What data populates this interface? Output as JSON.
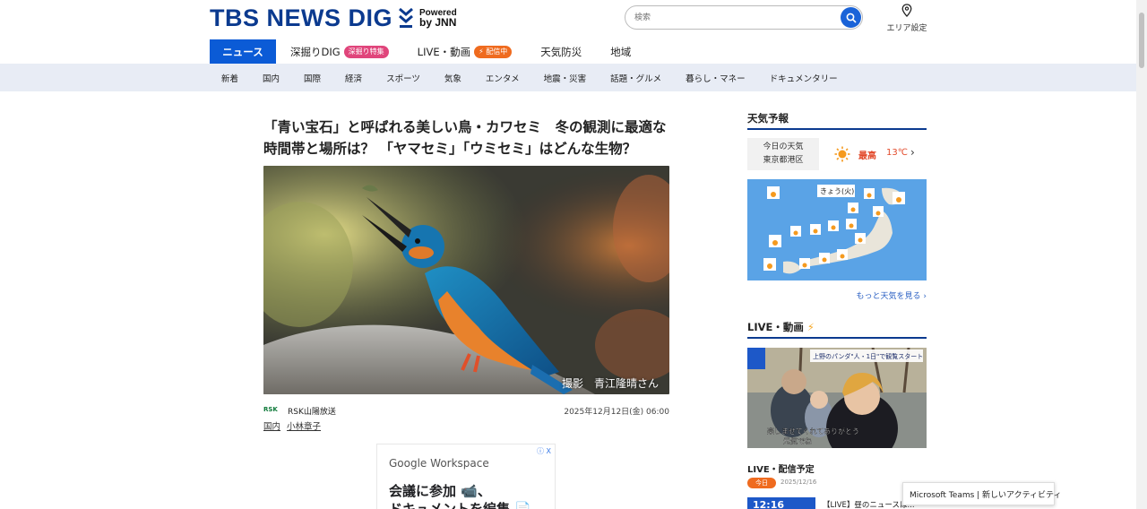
{
  "header": {
    "logo_text": "TBS NEWS DIG",
    "powered_line1": "Powered",
    "powered_line2": "by JNN",
    "search_placeholder": "検索",
    "area_label": "エリア設定"
  },
  "nav": {
    "tabs": [
      {
        "label": "ニュース",
        "active": true
      },
      {
        "label": "深掘りDIG",
        "badge": "深掘り特集"
      },
      {
        "label": "LIVE・動画",
        "badge": "⚡ 配信中"
      },
      {
        "label": "天気防災"
      },
      {
        "label": "地域"
      }
    ],
    "subnav": [
      "新着",
      "国内",
      "国際",
      "経済",
      "スポーツ",
      "気象",
      "エンタメ",
      "地震・災害",
      "話題・グルメ",
      "暮らし・マネー",
      "ドキュメンタリー"
    ]
  },
  "article": {
    "headline": "「青い宝石」と呼ばれる美しい鳥・カワセミ　冬の観測に最適な時間帯と場所は？ 「ヤマセミ」「ウミセミ」はどんな生物？",
    "photo_caption": "撮影　青江隆晴さん",
    "source_logo": "RSK",
    "source_name": "RSK山陽放送",
    "date": "2025年12月12日(金) 06:00",
    "tags": [
      "国内",
      "小林章子"
    ]
  },
  "ad": {
    "info": "ⓘ X",
    "brand_google": "Google",
    "brand_workspace": "Workspace",
    "line1": "会議に参加 📹、",
    "line2": "ドキュメントを編集 📄"
  },
  "sidebar": {
    "weather_title": "天気予報",
    "weather_loc_line1": "今日の天気",
    "weather_loc_line2": "東京都港区",
    "weather_high_label": "最高",
    "weather_temp": "13℃",
    "map_title": "きょう(火)",
    "more_weather": "もっと天気を見る ›",
    "live_title": "LIVE・動画",
    "live_overlay_top": "上野のパンダ\"人・1日\"で観覧スタート",
    "live_overlay_bottom": "楽しませてくれてありがとう\n元気でね",
    "live_sub_title": "LIVE・配信予定",
    "sched_today": "今日",
    "sched_date": "2025/12/16",
    "sched_thumb": "12:16",
    "sched_text": "【LIVE】昼のニュースは..."
  },
  "toast": {
    "text": "Microsoft Teams | 新しいアクティビティ"
  },
  "colors": {
    "brand_blue": "#0b3a8f",
    "tab_blue": "#0b5bd6",
    "subnav_bg": "#e8ecf5",
    "accent_orange": "#ef6b1f",
    "accent_pink": "#e0457b"
  }
}
